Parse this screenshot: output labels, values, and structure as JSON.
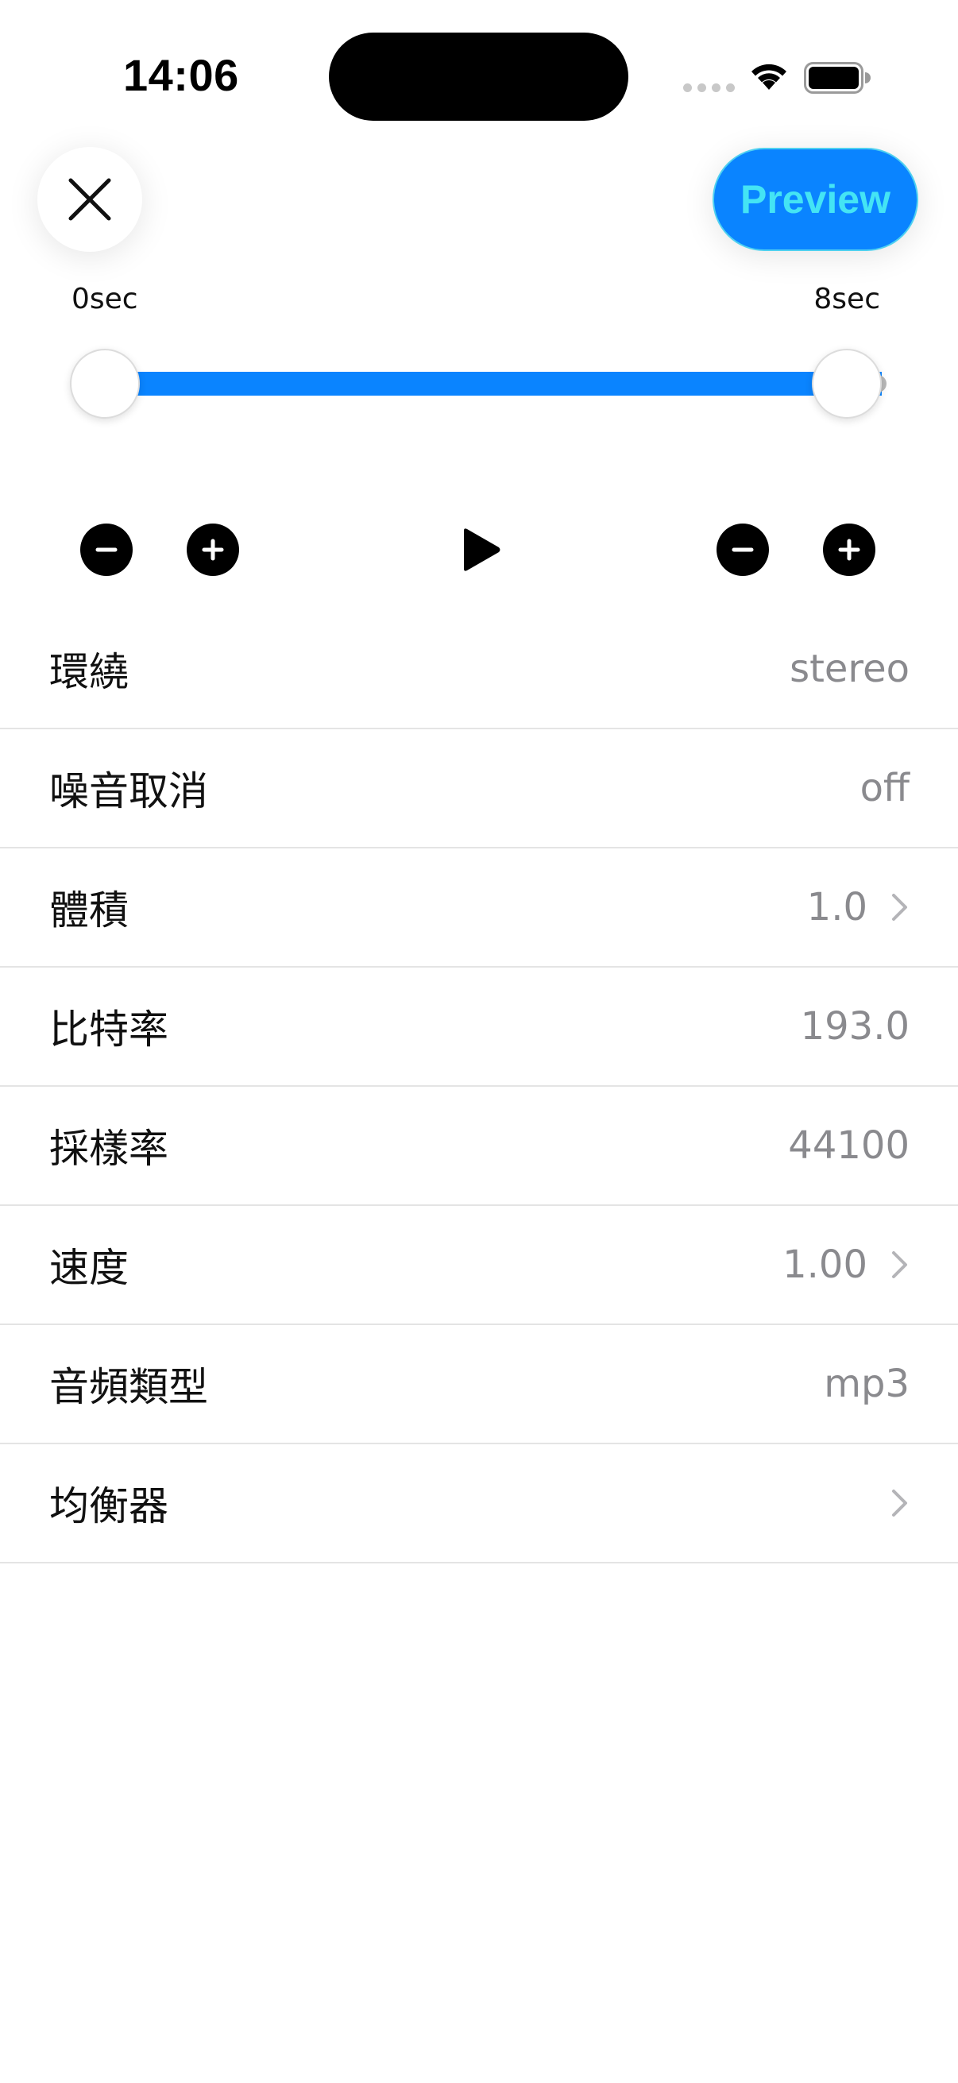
{
  "status_bar": {
    "time": "14:06"
  },
  "toolbar": {
    "close_icon": "close-icon",
    "preview_label": "Preview",
    "accent_color": "#0a84ff",
    "preview_text_color": "#44e4f4"
  },
  "trim": {
    "start_label": "0sec",
    "end_label": "8sec",
    "start_fraction": 0.0,
    "end_fraction": 1.0
  },
  "controls": {
    "left_minus_icon": "minus-circle-icon",
    "left_plus_icon": "plus-circle-icon",
    "play_icon": "play-icon",
    "right_minus_icon": "minus-circle-icon",
    "right_plus_icon": "plus-circle-icon"
  },
  "settings": [
    {
      "label": "環繞",
      "value": "stereo",
      "chevron": false
    },
    {
      "label": "噪音取消",
      "value": "off",
      "chevron": false
    },
    {
      "label": "體積",
      "value": "1.0",
      "chevron": true
    },
    {
      "label": "比特率",
      "value": "193.0",
      "chevron": false
    },
    {
      "label": "採樣率",
      "value": "44100",
      "chevron": false
    },
    {
      "label": "速度",
      "value": "1.00",
      "chevron": true
    },
    {
      "label": "音頻類型",
      "value": "mp3",
      "chevron": false
    },
    {
      "label": "均衡器",
      "value": "",
      "chevron": true
    }
  ]
}
